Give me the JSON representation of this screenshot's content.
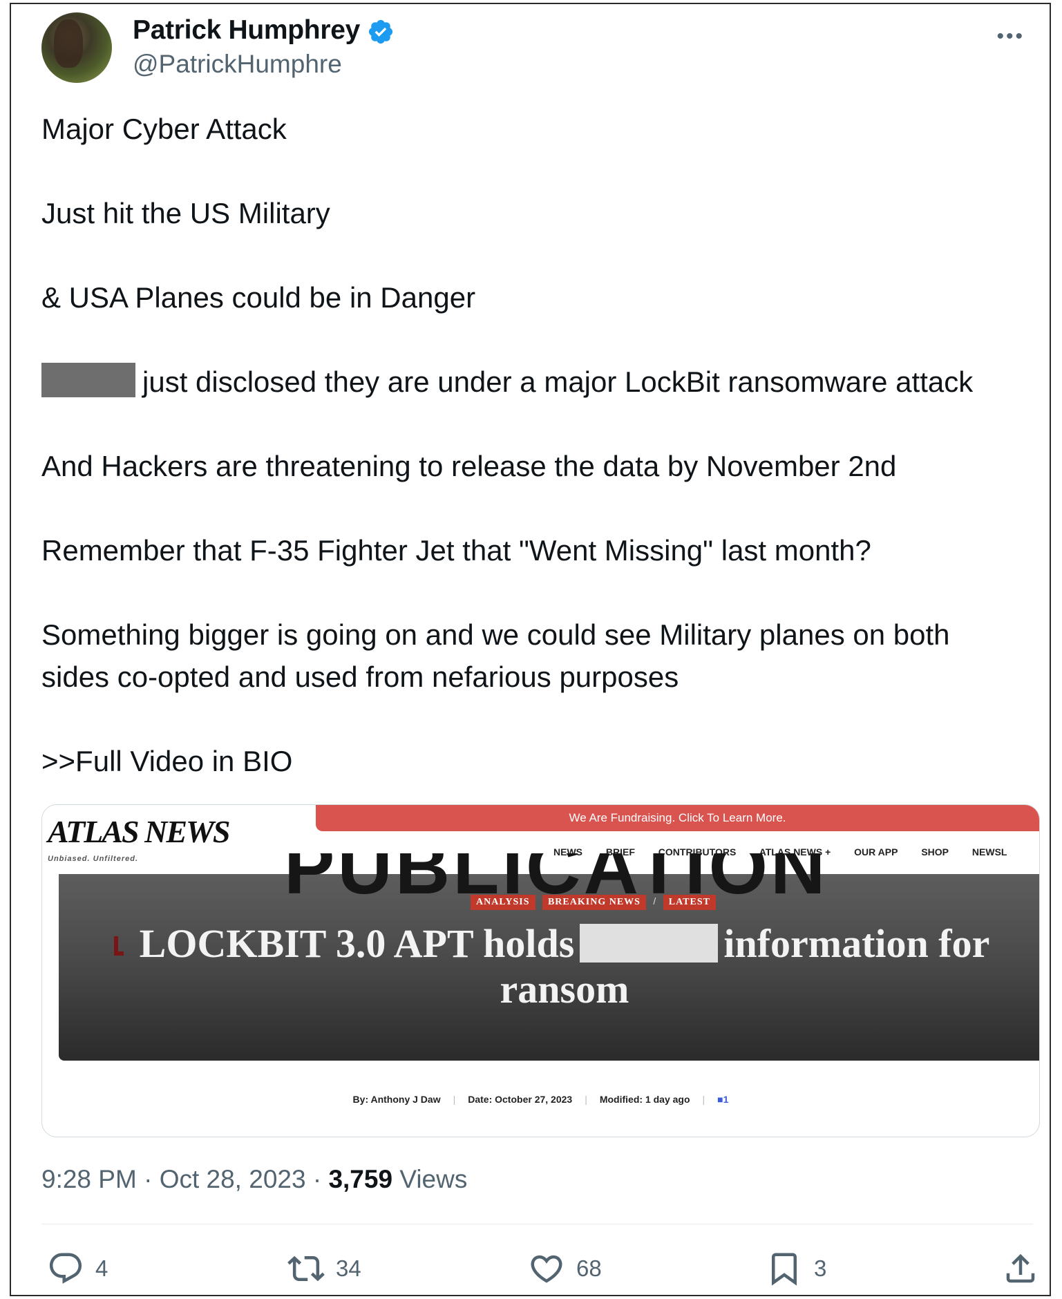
{
  "author": {
    "display_name": "Patrick Humphrey",
    "handle": "@PatrickHumphre",
    "verified_icon": "verified-badge-icon",
    "avatar_icon": "user-avatar"
  },
  "menu": {
    "more_label": "•••"
  },
  "tweet": {
    "lines": [
      "Major Cyber Attack",
      "Just hit the US Military",
      "& USA Planes could be in Danger",
      "just disclosed they are under a major LockBit ransomware attack",
      "And Hackers are threatening to release the data by November 2nd",
      "Remember that F-35 Fighter Jet that \"Went Missing\" last month?",
      "Something bigger is going on and we could see Military planes on both sides co-opted and used from nefarious purposes",
      ">>Full Video in BIO"
    ]
  },
  "card": {
    "logo": "ATLAS NEWS",
    "tagline": "Unbiased. Unfiltered.",
    "fundraising": "We Are Fundraising. Click To Learn More.",
    "nav": [
      "NEWS",
      "BRIEF",
      "CONTRIBUTORS",
      "ATLAS NEWS +",
      "OUR APP",
      "SHOP",
      "NEWSL"
    ],
    "background_word": "PUBLICATION",
    "badges": [
      "ANALYSIS",
      "BREAKING NEWS",
      "LATEST"
    ],
    "badge_separator": "/",
    "headline_part1": "LOCKBIT 3.0 APT holds",
    "headline_part2": "information for ransom",
    "byline": {
      "author": "By:  Anthony J Daw",
      "date": "Date:  October 27, 2023",
      "modified": "Modified: 1 day ago",
      "comments": "1"
    }
  },
  "meta": {
    "time": "9:28 PM",
    "separator": "·",
    "date": "Oct 28, 2023",
    "views_count": "3,759",
    "views_label": "Views"
  },
  "actions": {
    "replies": "4",
    "reposts": "34",
    "likes": "68",
    "bookmarks": "3"
  },
  "colors": {
    "text": "#0f1419",
    "secondary": "#536471",
    "verified": "#1d9bf0",
    "fund_bar": "#d9534f",
    "badge": "#c0392b"
  }
}
